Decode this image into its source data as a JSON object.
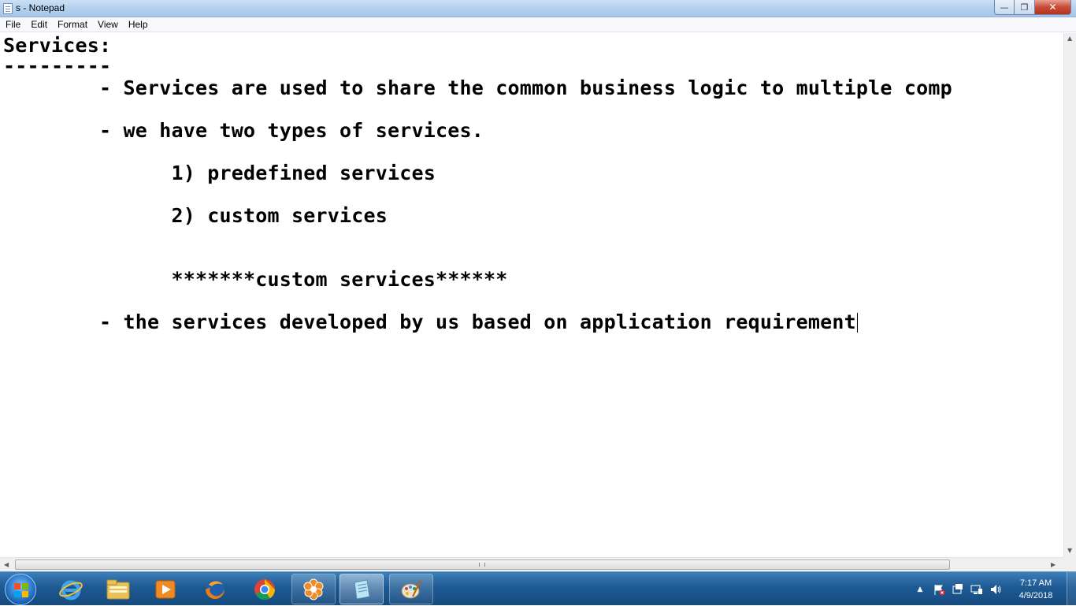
{
  "window": {
    "title": "s - Notepad",
    "minimize_glyph": "—",
    "maximize_glyph": "❐",
    "close_glyph": "✕"
  },
  "menu": {
    "items": [
      "File",
      "Edit",
      "Format",
      "View",
      "Help"
    ]
  },
  "document": {
    "lines": [
      "Services:",
      "---------",
      "        - Services are used to share the common business logic to multiple comp",
      "        - we have two types of services.",
      "              1) predefined services",
      "              2) custom services",
      "              *******custom services******",
      "        - the services developed by us based on application requirement"
    ]
  },
  "scrollbars": {
    "up_arrow": "▲",
    "down_arrow": "▼",
    "left_arrow": "◀",
    "right_arrow": "▶"
  },
  "taskbar": {
    "apps": [
      {
        "name": "internet-explorer",
        "icon": "e"
      },
      {
        "name": "file-explorer",
        "icon": "folder"
      },
      {
        "name": "media-player",
        "icon": "play"
      },
      {
        "name": "firefox",
        "icon": "firefox"
      },
      {
        "name": "chrome",
        "icon": "chrome"
      },
      {
        "name": "flower-app",
        "icon": "flower"
      },
      {
        "name": "notepad",
        "icon": "notepad"
      },
      {
        "name": "paint",
        "icon": "paint"
      }
    ],
    "tray": {
      "show_hidden": "▲"
    },
    "clock": {
      "time": "7:17 AM",
      "date": "4/9/2018"
    }
  }
}
